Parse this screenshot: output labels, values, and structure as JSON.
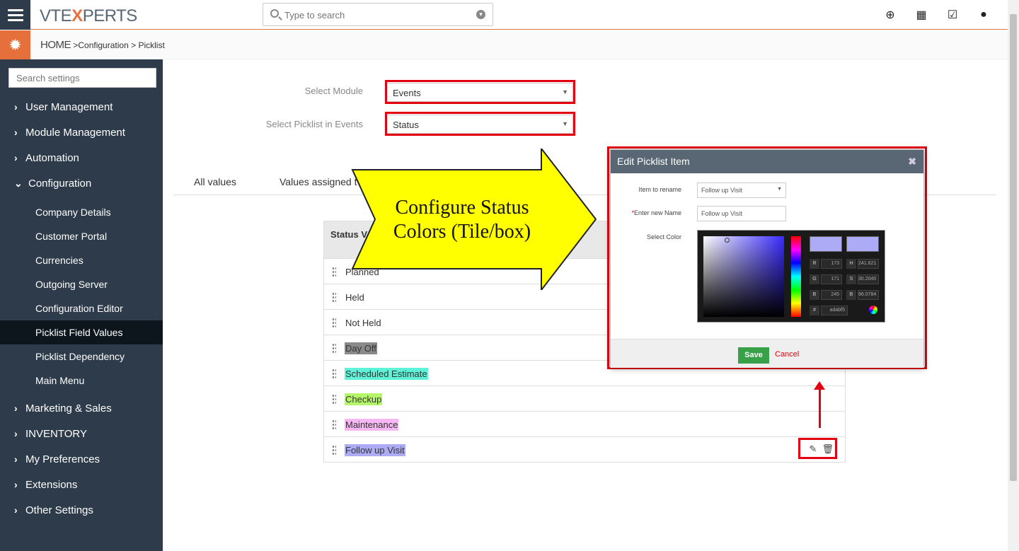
{
  "app": {
    "logo_left": "VTE",
    "logo_x": "X",
    "logo_right": "PERTS"
  },
  "search": {
    "placeholder": "Type to search"
  },
  "top_icons": [
    "plus-circle-icon",
    "calendar-icon",
    "checkbox-icon",
    "user-icon"
  ],
  "breadcrumb": {
    "home": "HOME",
    "sep1": ">",
    "configuration": "Configuration",
    "sep2": ">",
    "picklist": "Picklist"
  },
  "sidebar": {
    "search_placeholder": "Search settings",
    "items": [
      {
        "label": "User Management",
        "expanded": false
      },
      {
        "label": "Module Management",
        "expanded": false
      },
      {
        "label": "Automation",
        "expanded": false
      },
      {
        "label": "Configuration",
        "expanded": true
      },
      {
        "label": "Marketing & Sales",
        "expanded": false
      },
      {
        "label": "INVENTORY",
        "expanded": false
      },
      {
        "label": "My Preferences",
        "expanded": false
      },
      {
        "label": "Extensions",
        "expanded": false
      },
      {
        "label": "Other Settings",
        "expanded": false
      }
    ],
    "sub_items": [
      {
        "label": "Company Details"
      },
      {
        "label": "Customer Portal"
      },
      {
        "label": "Currencies"
      },
      {
        "label": "Outgoing Server"
      },
      {
        "label": "Configuration Editor"
      },
      {
        "label": "Picklist Field Values",
        "active": true
      },
      {
        "label": "Picklist Dependency"
      },
      {
        "label": "Main Menu"
      }
    ]
  },
  "form": {
    "module_label": "Select Module",
    "module_value": "Events",
    "picklist_label": "Select Picklist in Events",
    "picklist_value": "Status"
  },
  "tabs": {
    "all_values": "All values",
    "values_assigned": "Values assigned t"
  },
  "table": {
    "header": "Status V",
    "rows": [
      {
        "label": "Planned",
        "color": ""
      },
      {
        "label": "Held",
        "color": ""
      },
      {
        "label": "Not Held",
        "color": ""
      },
      {
        "label": "Day Off",
        "color": "#8a8a8a"
      },
      {
        "label": "Scheduled Estimate",
        "color": "#5ef2d8"
      },
      {
        "label": "Checkup",
        "color": "#b5f56a"
      },
      {
        "label": "Maintenance",
        "color": "#f5b8f2"
      },
      {
        "label": "Follow up Visit",
        "color": "#adabf5"
      }
    ]
  },
  "callout": {
    "text": "Configure Status Colors (Tile/box)"
  },
  "dialog": {
    "title": "Edit Picklist Item",
    "rename_label": "Item to rename",
    "rename_value": "Follow up Visit",
    "new_name_required": "*",
    "new_name_label": "Enter new Name",
    "new_name_value": "Follow up Visit",
    "color_label": "Select Color",
    "picker": {
      "R": "173",
      "G": "171",
      "B": "245",
      "H": "241.621",
      "S": "30.2040",
      "Bv": "96.0784",
      "hex": "adabf5",
      "r_key": "R",
      "g_key": "G",
      "b_key": "B",
      "h_key": "H",
      "s_key": "S",
      "bb_key": "B",
      "hash_key": "#"
    },
    "save": "Save",
    "cancel": "Cancel"
  }
}
